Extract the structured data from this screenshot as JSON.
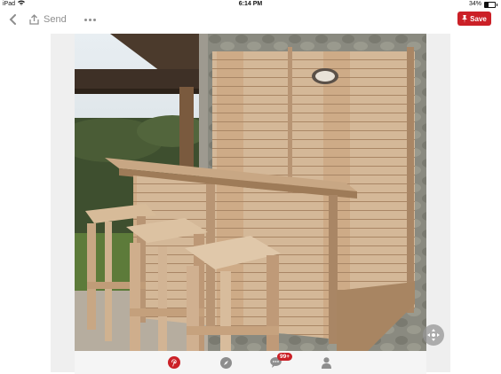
{
  "status_bar": {
    "device": "iPad",
    "time": "6:14 PM",
    "battery": "34%"
  },
  "toolbar": {
    "send_label": "Send",
    "save_label": "Save"
  },
  "bottom_nav": {
    "messages_badge": "99+"
  },
  "colors": {
    "accent": "#cb2027",
    "icon_gray": "#8e8e8e"
  },
  "icons": [
    "wifi-icon",
    "battery-icon",
    "back-chevron-icon",
    "share-icon",
    "more-icon",
    "pin-icon",
    "pinterest-logo-icon",
    "compass-icon",
    "speech-bubble-icon",
    "person-icon",
    "move-icon"
  ]
}
